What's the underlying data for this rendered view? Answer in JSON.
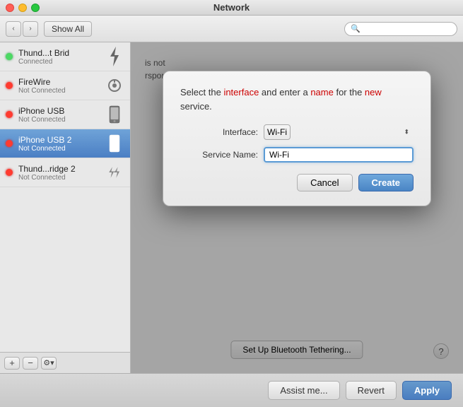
{
  "window": {
    "title": "Network",
    "buttons": {
      "close": "×",
      "minimize": "−",
      "maximize": "+"
    }
  },
  "toolbar": {
    "back_label": "‹",
    "forward_label": "›",
    "show_all_label": "Show All",
    "search_placeholder": ""
  },
  "sidebar": {
    "items": [
      {
        "name": "Thund...t Brid",
        "status": "Connected",
        "dot": "green",
        "icon_type": "thunderbolt"
      },
      {
        "name": "FireWire",
        "status": "Not Connected",
        "dot": "red",
        "icon_type": "firewire"
      },
      {
        "name": "iPhone USB",
        "status": "Not Connected",
        "dot": "red",
        "icon_type": "phone"
      },
      {
        "name": "iPhone USB 2",
        "status": "Not Connected",
        "dot": "red",
        "icon_type": "phone",
        "selected": true
      },
      {
        "name": "Thund...ridge 2",
        "status": "Not Connected",
        "dot": "red",
        "icon_type": "thunderbolt"
      }
    ],
    "footer_buttons": [
      "+",
      "−",
      "⚙"
    ]
  },
  "content": {
    "status_line1": "is not",
    "status_line2": "rsponding.",
    "bluetooth_btn": "Set Up Bluetooth Tethering...",
    "help_label": "?"
  },
  "bottom_bar": {
    "assist_label": "Assist me...",
    "revert_label": "Revert",
    "apply_label": "Apply"
  },
  "modal": {
    "title_part1": "Select the ",
    "title_interface": "interface",
    "title_part2": " and enter a ",
    "title_name": "name",
    "title_part3": " for the ",
    "title_new": "new",
    "title_part4": " service.",
    "interface_label": "Interface:",
    "interface_value": "Wi-Fi",
    "service_name_label": "Service Name:",
    "service_name_value": "Wi-Fi",
    "cancel_label": "Cancel",
    "create_label": "Create"
  }
}
